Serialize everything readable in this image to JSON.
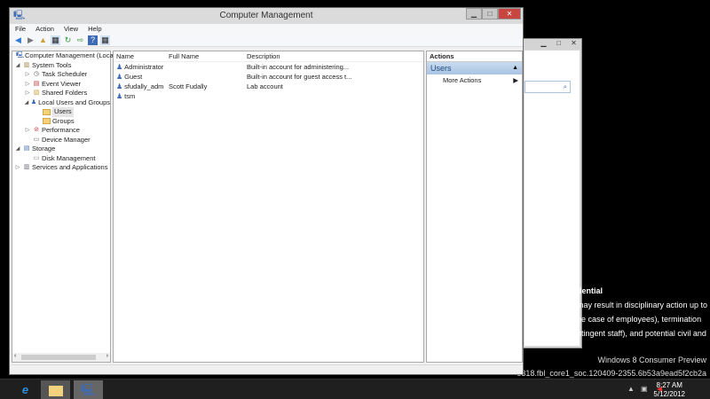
{
  "window": {
    "title": "Computer Management",
    "menu": [
      "File",
      "Action",
      "View",
      "Help"
    ]
  },
  "tree": [
    {
      "label": "Computer Management (Local",
      "level": 0,
      "expander": "",
      "icon": "computer-icon"
    },
    {
      "label": "System Tools",
      "level": 0,
      "expander": "◢",
      "icon": "tools-icon"
    },
    {
      "label": "Task Scheduler",
      "level": 1,
      "expander": "▷",
      "icon": "clock-icon"
    },
    {
      "label": "Event Viewer",
      "level": 1,
      "expander": "▷",
      "icon": "event-viewer-icon"
    },
    {
      "label": "Shared Folders",
      "level": 1,
      "expander": "▷",
      "icon": "shared-folder-icon"
    },
    {
      "label": "Local Users and Groups",
      "level": 1,
      "expander": "◢",
      "icon": "users-icon"
    },
    {
      "label": "Users",
      "level": 2,
      "expander": "",
      "icon": "folder-icon",
      "selected": true
    },
    {
      "label": "Groups",
      "level": 2,
      "expander": "",
      "icon": "folder-icon"
    },
    {
      "label": "Performance",
      "level": 1,
      "expander": "▷",
      "icon": "performance-icon"
    },
    {
      "label": "Device Manager",
      "level": 1,
      "expander": "",
      "icon": "device-manager-icon"
    },
    {
      "label": "Storage",
      "level": 0,
      "expander": "◢",
      "icon": "storage-icon"
    },
    {
      "label": "Disk Management",
      "level": 1,
      "expander": "",
      "icon": "disk-icon"
    },
    {
      "label": "Services and Applications",
      "level": 0,
      "expander": "▷",
      "icon": "services-icon"
    }
  ],
  "list": {
    "columns": [
      "Name",
      "Full Name",
      "Description"
    ],
    "rows": [
      {
        "name": "Administrator",
        "full_name": "",
        "description": "Built-in account for administering..."
      },
      {
        "name": "Guest",
        "full_name": "",
        "description": "Built-in account for guest access t..."
      },
      {
        "name": "sfudally_adm",
        "full_name": "Scott Fudally",
        "description": "Lab account"
      },
      {
        "name": "tsm",
        "full_name": "",
        "description": ""
      }
    ]
  },
  "actions": {
    "title": "Actions",
    "group": "Users",
    "items": [
      "More Actions"
    ]
  },
  "background": {
    "text_lines": [
      "dential",
      "may result in disciplinary action up to",
      "he case of employees), termination",
      "ntingent staff), and potential civil and"
    ],
    "watermark": [
      "Windows 8 Consumer Preview",
      "8318.fbl_core1_soc.120409-2355.6b53a9ead5f2cb2a"
    ]
  },
  "taskbar": {
    "time": "8:27 AM",
    "date": "5/12/2012"
  }
}
